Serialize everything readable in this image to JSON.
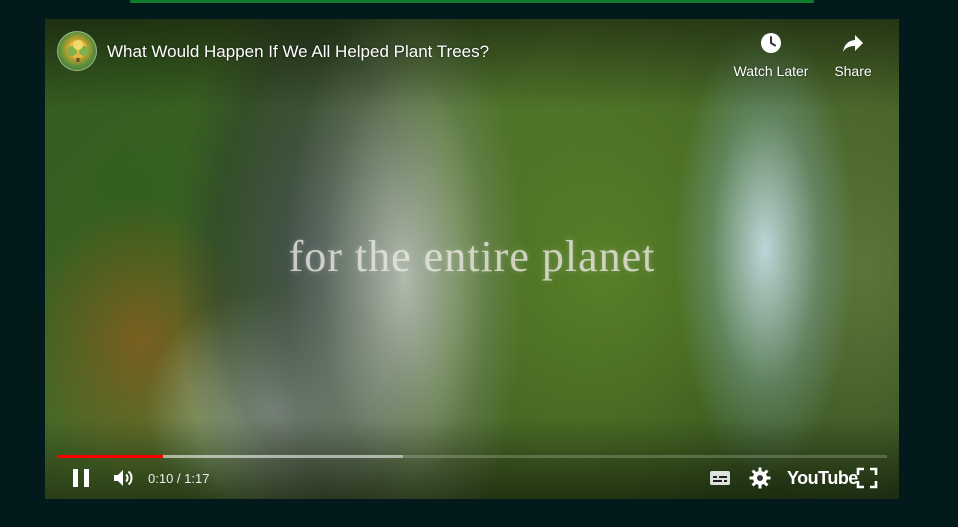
{
  "player": {
    "title": "What Would Happen If We All Helped Plant Trees?",
    "overlay_caption": "for the entire planet",
    "watch_later_label": "Watch Later",
    "share_label": "Share",
    "time_display": "0:10 / 1:17",
    "played_fraction": 0.128,
    "buffered_fraction": 0.417,
    "youtube_label": "YouTube",
    "colors": {
      "progress_played": "#ff0000",
      "page_background": "#031a1c",
      "top_strip": "#127a2c"
    },
    "icons": [
      "channel-logo",
      "clock-icon",
      "share-icon",
      "pause-icon",
      "volume-icon",
      "subtitles-icon",
      "gear-icon",
      "fullscreen-icon"
    ]
  }
}
